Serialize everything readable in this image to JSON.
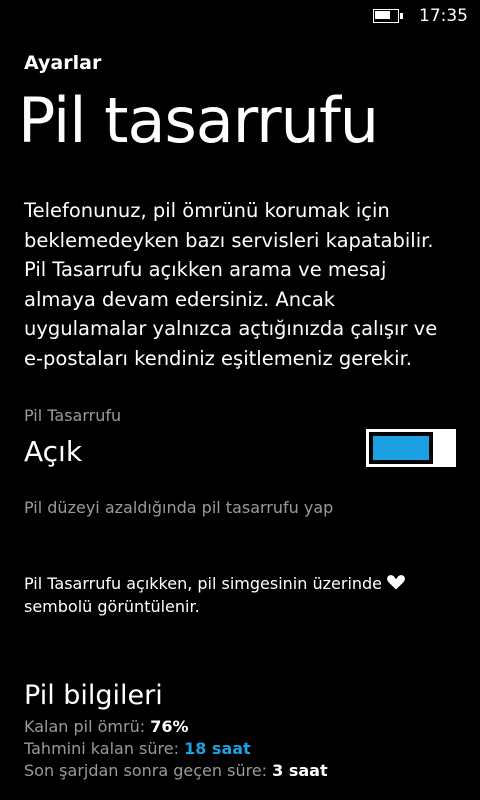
{
  "status_bar": {
    "battery_level": 0.75,
    "battery_icon": "battery-icon",
    "time": "17:35"
  },
  "header": {
    "app_title": "Ayarlar",
    "page_title": "Pil tasarrufu"
  },
  "description": "Telefonunuz, pil ömrünü korumak için beklemedeyken bazı servisleri kapatabilir. Pil Tasarrufu açıkken arama ve mesaj almaya devam edersiniz. Ancak uygulamalar yalnızca açtığınızda çalışır ve e-postaları kendiniz eşitlemeniz gerekir.",
  "toggle": {
    "header": "Pil Tasarrufu",
    "state_label": "Açık",
    "is_on": true,
    "accent_color": "#1ba1e2"
  },
  "low_battery_option": "Pil düzeyi azaldığında pil tasarrufu yap",
  "indicator_note": {
    "text_before": "Pil Tasarrufu açıkken, pil simgesinin üzerinde",
    "icon": "heart-icon",
    "text_after": "sembolü görüntülenir."
  },
  "battery_info": {
    "heading": "Pil bilgileri",
    "rows": [
      {
        "label": "Kalan pil ömrü:",
        "value": "76%"
      },
      {
        "label": "Tahmini kalan süre:",
        "value": "18 saat"
      },
      {
        "label": "Son şarjdan sonra geçen süre:",
        "value": "3 saat"
      }
    ]
  }
}
